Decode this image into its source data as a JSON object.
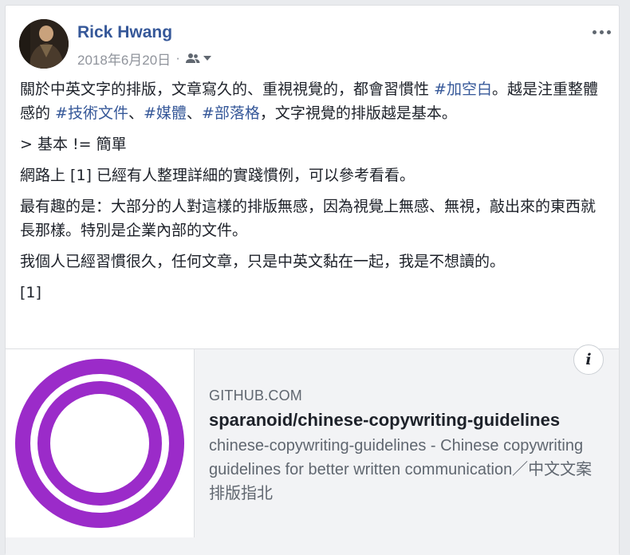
{
  "post": {
    "author": "Rick Hwang",
    "date": "2018年6月20日",
    "separator": "·",
    "audience_icon": "friends-icon",
    "paragraphs": {
      "p1_text_1": "關於中英文字的排版，文章寫久的、重視視覺的，都會習慣性 ",
      "p1_tag_1": "#加空白",
      "p1_text_2": "。越是注重整體感的 ",
      "p1_tag_2": "#技術文件",
      "p1_text_3": "、",
      "p1_tag_3": "#媒體",
      "p1_text_4": "、",
      "p1_tag_4": "#部落格",
      "p1_text_5": "，文字視覺的排版越是基本。",
      "p2": "> 基本 != 簡單",
      "p3": "網路上 [1] 已經有人整理詳細的實踐慣例，可以參考看看。",
      "p4": "最有趣的是：大部分的人對這樣的排版無感，因為視覺上無感、無視，敲出來的東西就長那樣。特別是企業內部的文件。",
      "p5": "我個人已經習慣很久，任何文章，只是中英文黏在一起，我是不想讀的。",
      "p6": "[1]"
    }
  },
  "link_preview": {
    "domain": "GITHUB.COM",
    "title": "sparanoid/chinese-copywriting-guidelines",
    "description": "chinese-copywriting-guidelines - Chinese copywriting guidelines for better written communication／中文文案排版指北",
    "info_label": "i",
    "thumbnail_color": "#9b2bc9"
  },
  "colors": {
    "link": "#365899",
    "text": "#1d2129",
    "muted": "#90949c"
  }
}
